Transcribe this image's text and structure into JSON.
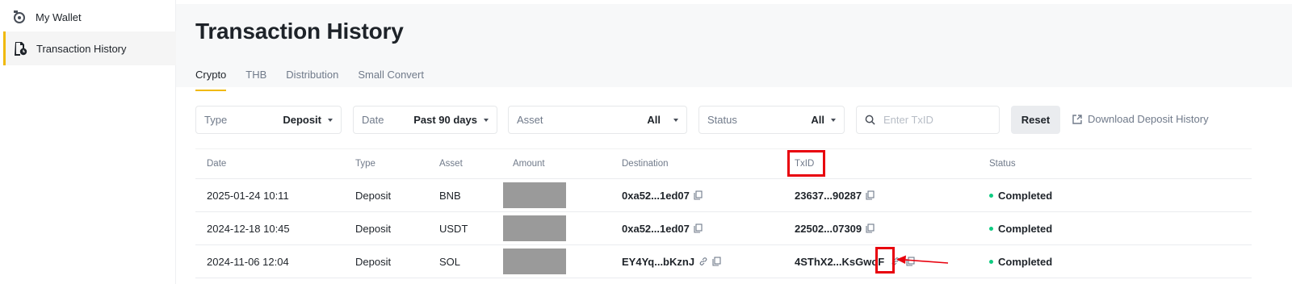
{
  "sidebar": {
    "items": [
      {
        "label": "My Wallet",
        "icon": "wallet-icon",
        "active": false
      },
      {
        "label": "Transaction History",
        "icon": "history-icon",
        "active": true
      }
    ]
  },
  "page": {
    "title": "Transaction History",
    "tabs": [
      "Crypto",
      "THB",
      "Distribution",
      "Small Convert"
    ],
    "active_tab": "Crypto"
  },
  "filters": {
    "type": {
      "label": "Type",
      "value": "Deposit"
    },
    "date": {
      "label": "Date",
      "value": "Past 90 days"
    },
    "asset": {
      "label": "Asset",
      "value": "All"
    },
    "status": {
      "label": "Status",
      "value": "All"
    },
    "search": {
      "placeholder": "Enter TxID",
      "value": ""
    },
    "reset_label": "Reset",
    "download_label": "Download Deposit History"
  },
  "table": {
    "headers": {
      "date": "Date",
      "type": "Type",
      "asset": "Asset",
      "amount": "Amount",
      "destination": "Destination",
      "txid": "TxID",
      "status": "Status"
    },
    "rows": [
      {
        "date": "2025-01-24 10:11",
        "type": "Deposit",
        "asset": "BNB",
        "destination": "0xa52...1ed07",
        "txid": "23637...90287",
        "status": "Completed"
      },
      {
        "date": "2024-12-18 10:45",
        "type": "Deposit",
        "asset": "USDT",
        "destination": "0xa52...1ed07",
        "txid": "22502...07309",
        "status": "Completed"
      },
      {
        "date": "2024-11-06 12:04",
        "type": "Deposit",
        "asset": "SOL",
        "destination": "EY4Yq...bKznJ",
        "txid": "4SThX2...KsGwoF",
        "status": "Completed"
      }
    ]
  },
  "colors": {
    "accent": "#f0b90b",
    "status_completed": "#0ecb81",
    "annotation": "#e8000d",
    "redacted": "#9a9a9a"
  }
}
